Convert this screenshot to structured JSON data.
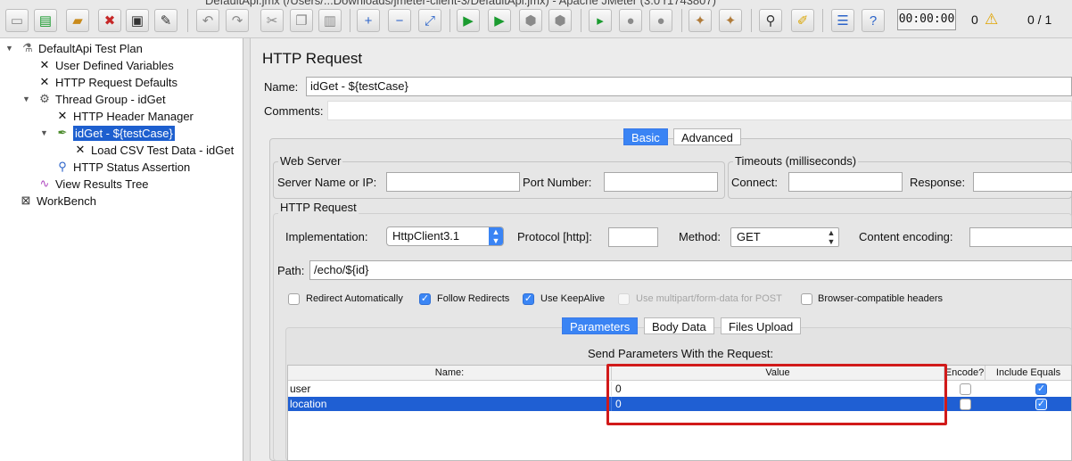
{
  "window": {
    "title": "DefaultApi.jmx (/Users/...Downloads/jmeter-client-3/DefaultApi.jmx) - Apache JMeter (3.0 r1743807)"
  },
  "toolbar": {
    "timer": "00:00:00",
    "error_count": "0",
    "threads": "0 / 1",
    "icons": [
      "new-icon",
      "templates-icon",
      "open-icon",
      "close-icon",
      "save-icon",
      "save-as-icon",
      "undo-icon",
      "redo-icon",
      "cut-icon",
      "copy-icon",
      "paste-icon",
      "expand-icon",
      "collapse-icon",
      "toggle-icon",
      "start-icon",
      "start-no-pause-icon",
      "stop-icon",
      "shutdown-icon",
      "remote-start-icon",
      "remote-start-all-icon",
      "clear-icon",
      "clear-all-icon",
      "search-icon",
      "reset-search-icon",
      "function-helper-icon",
      "help-icon"
    ]
  },
  "tree": {
    "items": [
      {
        "label": "DefaultApi Test Plan",
        "icon": "flask-icon"
      },
      {
        "label": "User Defined Variables",
        "icon": "tools-icon"
      },
      {
        "label": "HTTP Request Defaults",
        "icon": "tools-icon"
      },
      {
        "label": "Thread Group - idGet",
        "icon": "gear-icon"
      },
      {
        "label": "HTTP Header Manager",
        "icon": "tools-icon"
      },
      {
        "label": "idGet - ${testCase}",
        "icon": "pipette-icon",
        "selected": true
      },
      {
        "label": "Load CSV Test Data - idGet",
        "icon": "tools-icon"
      },
      {
        "label": "HTTP Status Assertion",
        "icon": "magnifier-icon"
      },
      {
        "label": "View Results Tree",
        "icon": "chart-icon"
      },
      {
        "label": "WorkBench",
        "icon": "workbench-icon"
      }
    ]
  },
  "panel": {
    "title": "HTTP Request",
    "name_label": "Name:",
    "name_value": "idGet - ${testCase}",
    "comments_label": "Comments:",
    "tabs": [
      "Basic",
      "Advanced"
    ],
    "web_server": {
      "legend": "Web Server",
      "server_label": "Server Name or IP:",
      "port_label": "Port Number:"
    },
    "timeouts": {
      "legend": "Timeouts (milliseconds)",
      "connect_label": "Connect:",
      "response_label": "Response:"
    },
    "http_request": {
      "legend": "HTTP Request",
      "implementation_label": "Implementation:",
      "implementation_value": "HttpClient3.1",
      "protocol_label": "Protocol [http]:",
      "method_label": "Method:",
      "method_value": "GET",
      "encoding_label": "Content encoding:",
      "path_label": "Path:",
      "path_value": "/echo/${id}"
    },
    "options": [
      {
        "label": "Redirect Automatically",
        "checked": false,
        "disabled": false
      },
      {
        "label": "Follow Redirects",
        "checked": true,
        "disabled": false
      },
      {
        "label": "Use KeepAlive",
        "checked": true,
        "disabled": false
      },
      {
        "label": "Use multipart/form-data for POST",
        "checked": false,
        "disabled": true
      },
      {
        "label": "Browser-compatible headers",
        "checked": false,
        "disabled": false
      }
    ],
    "subtabs": [
      "Parameters",
      "Body Data",
      "Files Upload"
    ],
    "params_caption": "Send Parameters With the Request:",
    "table": {
      "headers": [
        "Name:",
        "Value",
        "Encode?",
        "Include Equals"
      ],
      "rows": [
        {
          "name": "user",
          "value": "0",
          "encode": false,
          "include_equals": true
        },
        {
          "name": "location",
          "value": "0",
          "encode": false,
          "include_equals": true
        }
      ]
    }
  },
  "colors": {
    "accent": "#3a84f4",
    "selection": "#1f5fd3",
    "highlight": "#d11a1a"
  }
}
